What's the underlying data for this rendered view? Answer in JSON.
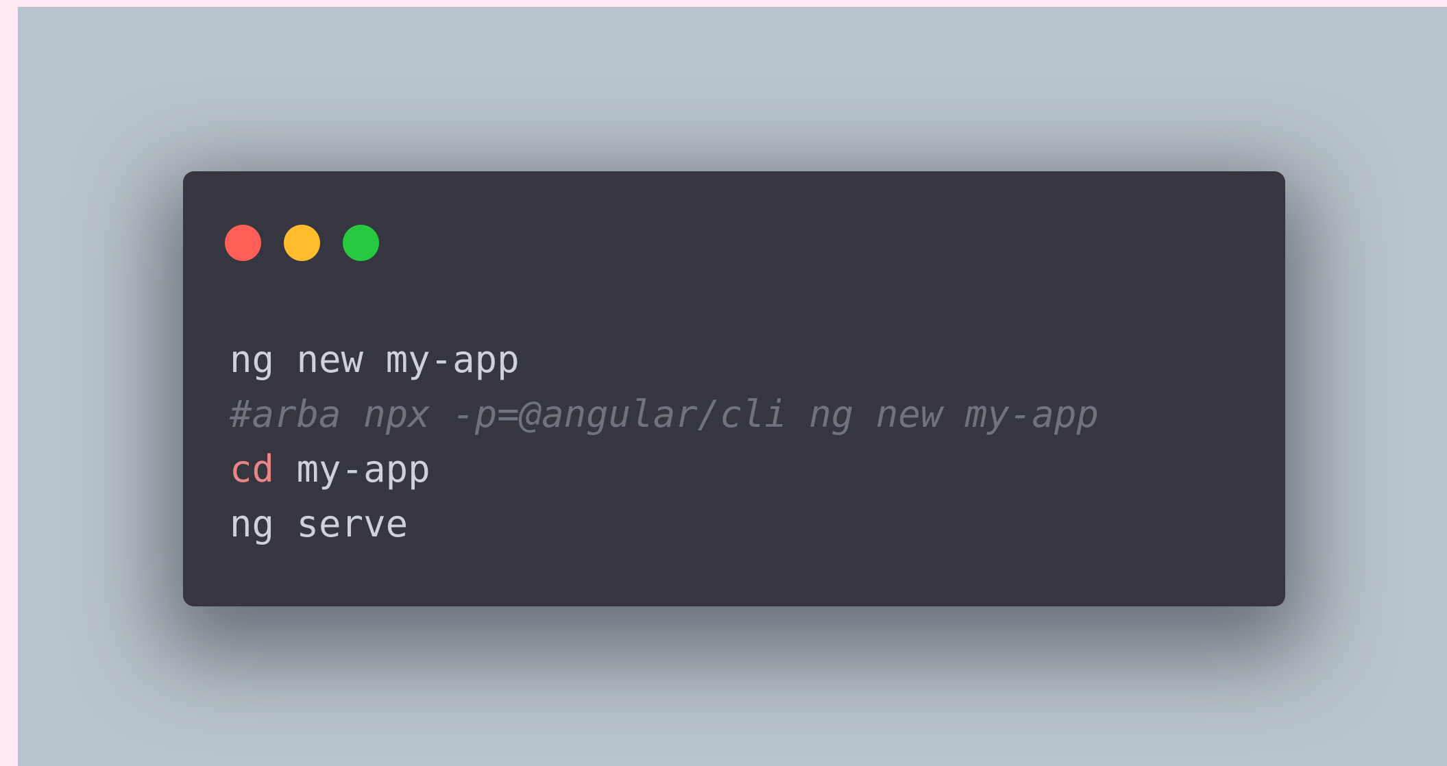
{
  "window": {
    "lights": [
      {
        "name": "close",
        "color": "#ff5f57"
      },
      {
        "name": "minimize",
        "color": "#febc2e"
      },
      {
        "name": "zoom",
        "color": "#28c840"
      }
    ]
  },
  "code": {
    "line1": "ng new my-app",
    "line2": "#arba npx -p=@angular/cli ng new my-app",
    "line3_keyword": "cd",
    "line3_rest": " my-app",
    "line4": "ng serve"
  },
  "colors": {
    "keyword": "#e98586",
    "text": "#cdd2d8",
    "comment": "#6e737d",
    "window_bg": "#363641",
    "backdrop": "#b9c3cb"
  }
}
